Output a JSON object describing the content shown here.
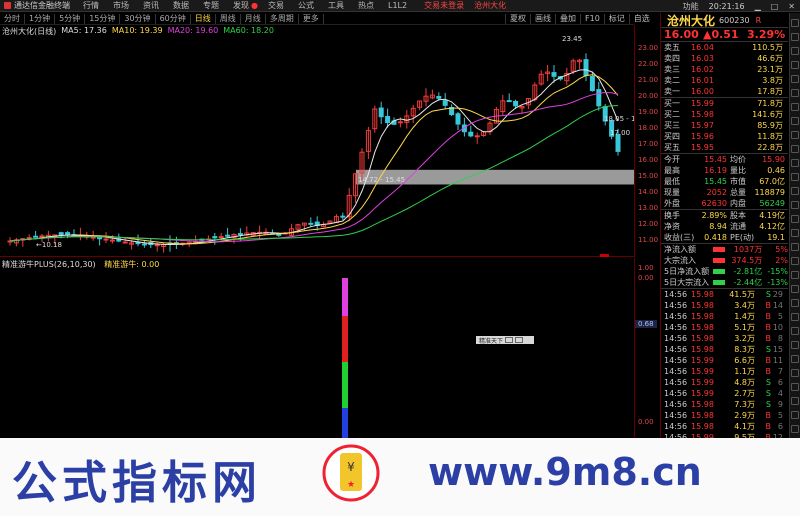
{
  "titlebar": {
    "app_name": "通达信金融终端",
    "menus": [
      "行情",
      "市场",
      "资讯",
      "数据",
      "专题",
      "发现",
      "交易",
      "公式",
      "工具",
      "热点",
      "L1L2"
    ],
    "ticker_text": "交易未登录",
    "stock_link": "沧州大化",
    "right_buttons": [
      "夏权",
      "画线",
      "叠加",
      "F10",
      "标记",
      "自选"
    ]
  },
  "periods": [
    "分时",
    "1分钟",
    "5分钟",
    "15分钟",
    "30分钟",
    "60分钟",
    "日线",
    "周线",
    "月线",
    "多周期",
    "更多"
  ],
  "active_period": "日线",
  "legend": {
    "stock": "沧州大化(日线)",
    "ma5": "MA5: 17.36",
    "ma10": "MA10: 19.39",
    "ma20": "MA20: 19.60",
    "ma60": "MA60: 18.20"
  },
  "colors": {
    "ma5": "#e8e8e8",
    "ma10": "#ffd84a",
    "ma20": "#e040e0",
    "ma60": "#2fd14b",
    "up": "#f33b3b",
    "down": "#36c8d8"
  },
  "annotations": {
    "high": "23.45",
    "low_label": "10.18",
    "mid_label": "14.72 - 15.45",
    "price_mark_a": "18.05 - 17",
    "price_mark_b": "17.00"
  },
  "y_axis": [
    "23.00",
    "22.00",
    "21.00",
    "20.00",
    "19.00",
    "18.00",
    "17.00",
    "16.00",
    "15.00",
    "14.00",
    "13.00",
    "12.00",
    "11.00"
  ],
  "indicator": {
    "name": "精准游牛PLUS(26,10,30)",
    "value_label": "精准游牛: 0.00",
    "y_axis": [
      "1.00",
      "0.00",
      "0.00"
    ],
    "cursor_value": "0.68"
  },
  "float_button": "精准天下",
  "panel": {
    "name": "沧州大化",
    "code": "600230",
    "flag": "R",
    "price": "16.00",
    "change": "0.51",
    "pct": "3.29%",
    "asks": [
      {
        "label": "卖五",
        "price": "16.04",
        "vol": "110.5万"
      },
      {
        "label": "卖四",
        "price": "16.03",
        "vol": "46.6万"
      },
      {
        "label": "卖三",
        "price": "16.02",
        "vol": "23.1万"
      },
      {
        "label": "卖二",
        "price": "16.01",
        "vol": "3.8万"
      },
      {
        "label": "卖一",
        "price": "16.00",
        "vol": "17.8万"
      }
    ],
    "bids": [
      {
        "label": "买一",
        "price": "15.99",
        "vol": "71.8万"
      },
      {
        "label": "买二",
        "price": "15.98",
        "vol": "141.6万"
      },
      {
        "label": "买三",
        "price": "15.97",
        "vol": "85.9万"
      },
      {
        "label": "买四",
        "price": "15.96",
        "vol": "11.8万"
      },
      {
        "label": "买五",
        "price": "15.95",
        "vol": "22.8万"
      }
    ],
    "stats": [
      {
        "l1": "今开",
        "v1": "15.45",
        "c1": "red",
        "l2": "均价",
        "v2": "15.90",
        "c2": "red"
      },
      {
        "l1": "最高",
        "v1": "16.19",
        "c1": "red",
        "l2": "量比",
        "v2": "0.46",
        "c2": "yel"
      },
      {
        "l1": "最低",
        "v1": "15.45",
        "c1": "grn",
        "l2": "市值",
        "v2": "67.0亿",
        "c2": "yel"
      },
      {
        "l1": "现量",
        "v1": "2052",
        "c1": "red",
        "l2": "总量",
        "v2": "118879",
        "c2": "yel"
      },
      {
        "l1": "外盘",
        "v1": "62630",
        "c1": "red",
        "l2": "内盘",
        "v2": "56249",
        "c2": "grn"
      }
    ],
    "stats2": [
      {
        "l1": "换手",
        "v1": "2.89%",
        "c1": "yel",
        "l2": "股本",
        "v2": "4.19亿",
        "c2": "yel"
      },
      {
        "l1": "净资",
        "v1": "8.94",
        "c1": "yel",
        "l2": "流通",
        "v2": "4.12亿",
        "c2": "yel"
      },
      {
        "l1": "收益(三)",
        "v1": "0.418",
        "c1": "yel",
        "l2": "PE(动)",
        "v2": "19.1",
        "c2": "yel"
      }
    ],
    "flows": [
      {
        "label": "净流入额",
        "value": "1037万",
        "pct": "5%",
        "c": "red",
        "bar": "r"
      },
      {
        "label": "大宗流入",
        "value": "374.5万",
        "pct": "2%",
        "c": "red",
        "bar": "r"
      },
      {
        "label": "5日净流入额",
        "value": "-2.81亿",
        "pct": "-15%",
        "c": "grn",
        "bar": "g"
      },
      {
        "label": "5日大宗流入",
        "value": "-2.44亿",
        "pct": "-13%",
        "c": "grn",
        "bar": "g"
      }
    ],
    "ticks": [
      {
        "t": "14:56",
        "p": "15.98",
        "v": "41.5万",
        "d": "S",
        "c": "grn",
        "n": "29"
      },
      {
        "t": "14:56",
        "p": "15.98",
        "v": "3.4万",
        "d": "B",
        "c": "red",
        "n": "14"
      },
      {
        "t": "14:56",
        "p": "15.98",
        "v": "1.4万",
        "d": "B",
        "c": "red",
        "n": "5"
      },
      {
        "t": "14:56",
        "p": "15.98",
        "v": "5.1万",
        "d": "B",
        "c": "red",
        "n": "10"
      },
      {
        "t": "14:56",
        "p": "15.98",
        "v": "3.2万",
        "d": "B",
        "c": "red",
        "n": "8"
      },
      {
        "t": "14:56",
        "p": "15.98",
        "v": "8.3万",
        "d": "S",
        "c": "grn",
        "n": "15"
      },
      {
        "t": "14:56",
        "p": "15.99",
        "v": "6.6万",
        "d": "B",
        "c": "red",
        "n": "11"
      },
      {
        "t": "14:56",
        "p": "15.99",
        "v": "1.1万",
        "d": "B",
        "c": "red",
        "n": "7"
      },
      {
        "t": "14:56",
        "p": "15.99",
        "v": "4.8万",
        "d": "S",
        "c": "grn",
        "n": "6"
      },
      {
        "t": "14:56",
        "p": "15.99",
        "v": "2.7万",
        "d": "S",
        "c": "grn",
        "n": "4"
      },
      {
        "t": "14:56",
        "p": "15.98",
        "v": "7.3万",
        "d": "S",
        "c": "grn",
        "n": "9"
      },
      {
        "t": "14:56",
        "p": "15.98",
        "v": "2.9万",
        "d": "B",
        "c": "red",
        "n": "5"
      },
      {
        "t": "14:56",
        "p": "15.98",
        "v": "4.1万",
        "d": "B",
        "c": "red",
        "n": "6"
      },
      {
        "t": "14:56",
        "p": "15.99",
        "v": "9.5万",
        "d": "B",
        "c": "red",
        "n": "12"
      }
    ]
  },
  "watermark": {
    "text": "公式指标网",
    "url": "www.9m8.cn",
    "logo_url": "www.9m8.cn"
  }
}
